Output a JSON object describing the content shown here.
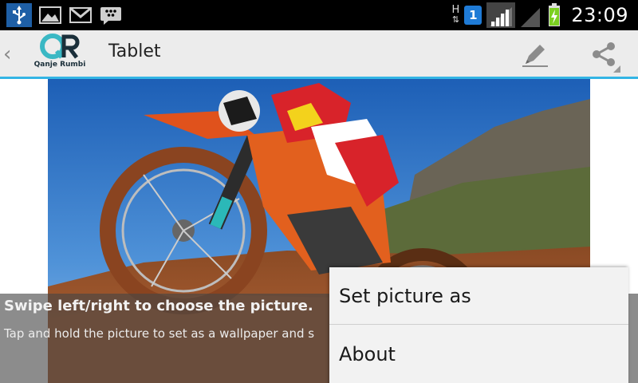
{
  "status_bar": {
    "left_icons": [
      "usb-icon",
      "gallery-icon",
      "gmail-icon",
      "bbm-icon"
    ],
    "network_type_top": "H",
    "network_type_bottom": "⇅",
    "sim_slot": "1",
    "clock": "23:09",
    "colors": {
      "background": "#000000",
      "usb_bg": "#1e5fa6",
      "sim_badge": "#1f7bd6",
      "battery_charge": "#7bd021"
    }
  },
  "action_bar": {
    "up_caret": "‹",
    "logo_name": "Qanje Rumbi",
    "title": "Tablet",
    "actions": [
      "edit-icon",
      "share-icon"
    ],
    "accent_color": "#33b5e5"
  },
  "photo": {
    "subject": "motocross-rider-photo"
  },
  "hint": {
    "title": "Swipe left/right to choose the picture.",
    "body": "Tap and hold the picture to set as a wallpaper and s"
  },
  "menu": {
    "items": [
      {
        "label": "Set picture as"
      },
      {
        "label": "About"
      }
    ]
  }
}
